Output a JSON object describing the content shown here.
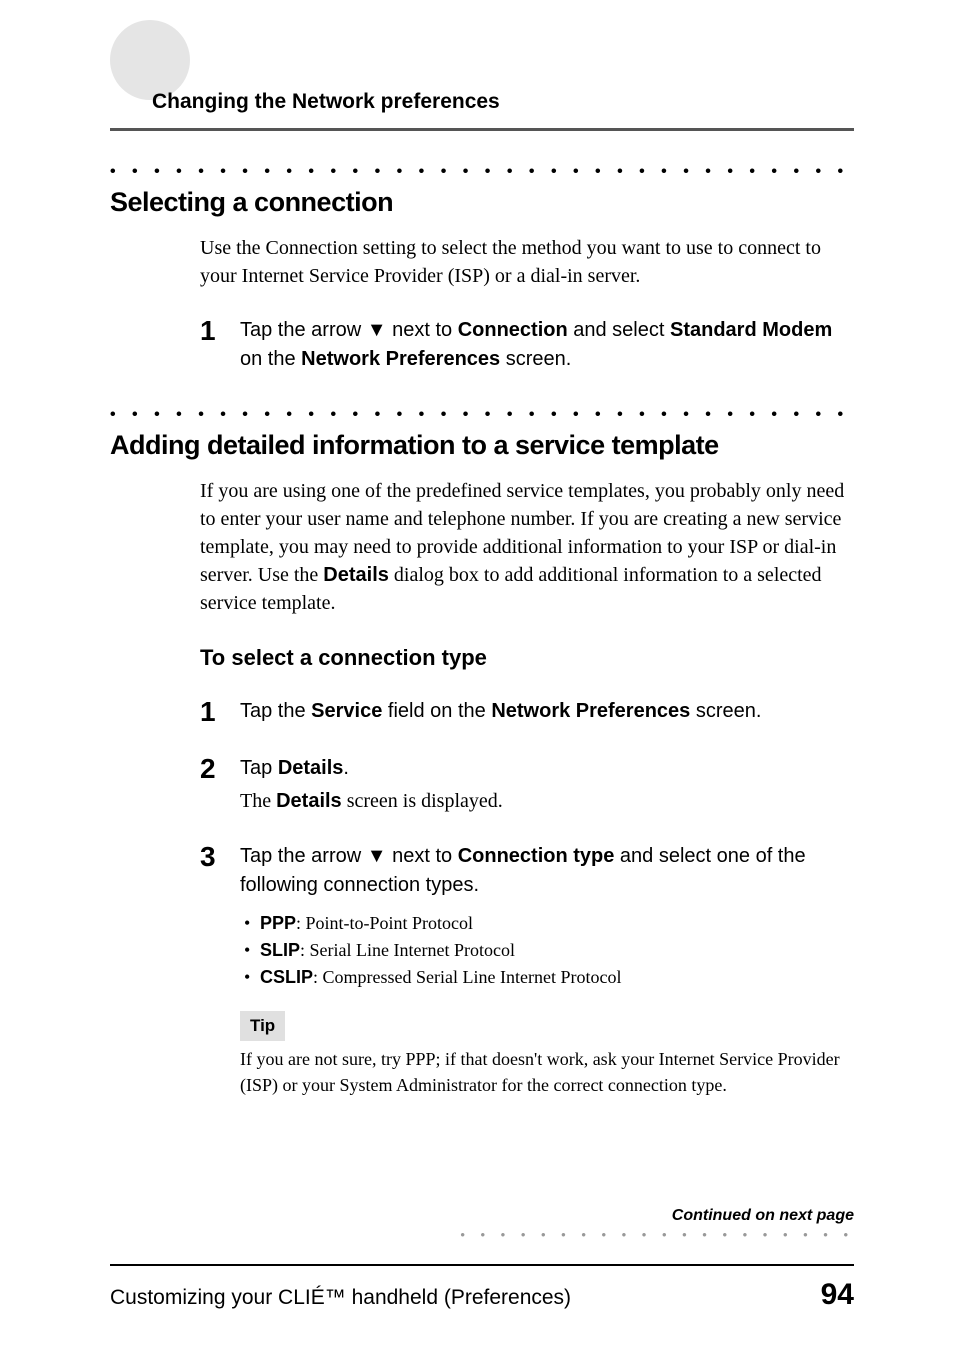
{
  "header": {
    "breadcrumb": "Changing the Network preferences"
  },
  "section1": {
    "title": "Selecting a connection",
    "intro": "Use the Connection setting to select the method you want to use to connect to your Internet Service Provider (ISP) or a dial-in server.",
    "step1": {
      "num": "1",
      "pre": "Tap the arrow ",
      "arrow": "▼",
      "mid": " next to ",
      "b1": "Connection",
      "mid2": " and select ",
      "b2": "Standard Modem",
      "mid3": " on the ",
      "b3": "Network Preferences",
      "post": " screen."
    }
  },
  "section2": {
    "title": "Adding detailed information to a service template",
    "intro_a": "If you are using one of the predefined service templates, you probably only need to enter your user name and telephone number. If you are creating a new service template, you may need to provide additional information to your ISP or dial-in server. Use the ",
    "intro_b_bold": "Details",
    "intro_c": " dialog box to add additional information to a selected service template.",
    "subhead": "To select a connection type",
    "step1": {
      "num": "1",
      "pre": "Tap the ",
      "b1": "Service",
      "mid": " field on the ",
      "b2": "Network Preferences",
      "post": " screen."
    },
    "step2": {
      "num": "2",
      "pre": "Tap ",
      "b1": "Details",
      "post": ".",
      "sub_a": "The ",
      "sub_b_bold": "Details",
      "sub_c": " screen is displayed."
    },
    "step3": {
      "num": "3",
      "pre": "Tap the arrow ",
      "arrow": "▼",
      "mid": " next to ",
      "b1": "Connection type",
      "post": " and select one of the following connection types.",
      "bullets": {
        "0": {
          "name": "PPP",
          "desc": ": Point-to-Point Protocol"
        },
        "1": {
          "name": "SLIP",
          "desc": ": Serial Line Internet Protocol"
        },
        "2": {
          "name": "CSLIP",
          "desc": ": Compressed Serial Line Internet Protocol"
        }
      },
      "tip_label": "Tip",
      "tip_text": "If you are not sure, try PPP; if that doesn't work, ask your Internet Service Provider (ISP) or your System Administrator for the correct connection type."
    }
  },
  "footer": {
    "continued": "Continued on next page",
    "left": "Customizing your CLIÉ™ handheld (Preferences)",
    "page": "94"
  },
  "dots": "• • • • • • • • • • • • • • • • • • • • • • • • • • • • • • • • • • • • • • • • • • • • • • • • • • • • • • • • • • •",
  "dots_small": "• • • • • • • • • • • • • • • • • • • •"
}
